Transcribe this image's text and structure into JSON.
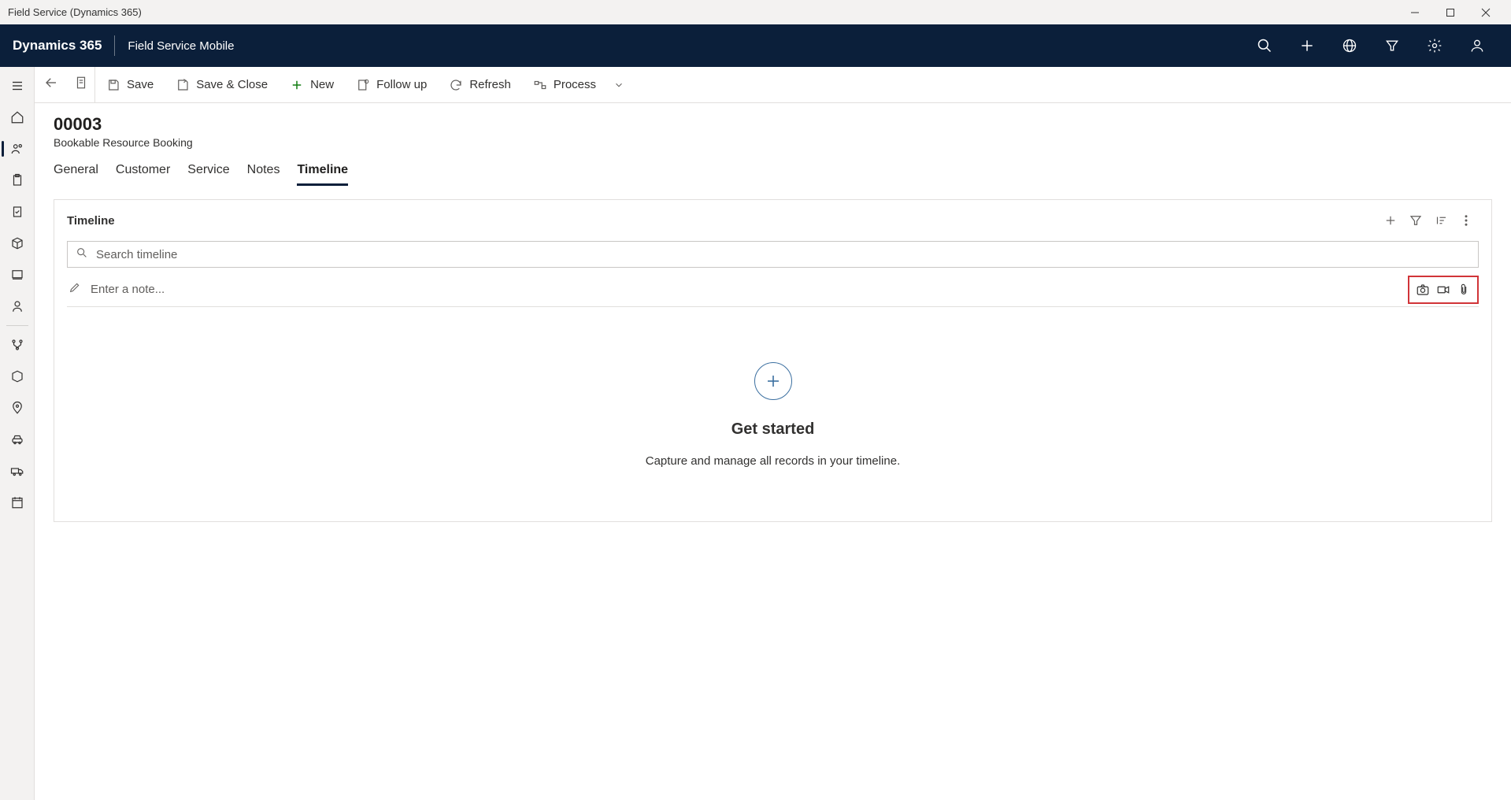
{
  "window": {
    "title": "Field Service (Dynamics 365)"
  },
  "header": {
    "brand": "Dynamics 365",
    "app": "Field Service Mobile"
  },
  "commands": {
    "save": "Save",
    "save_close": "Save & Close",
    "new": "New",
    "follow_up": "Follow up",
    "refresh": "Refresh",
    "process": "Process"
  },
  "record": {
    "id": "00003",
    "entity": "Bookable Resource Booking"
  },
  "tabs": [
    "General",
    "Customer",
    "Service",
    "Notes",
    "Timeline"
  ],
  "active_tab": "Timeline",
  "timeline": {
    "title": "Timeline",
    "search_placeholder": "Search timeline",
    "note_placeholder": "Enter a note...",
    "empty_title": "Get started",
    "empty_sub": "Capture and manage all records in your timeline."
  }
}
